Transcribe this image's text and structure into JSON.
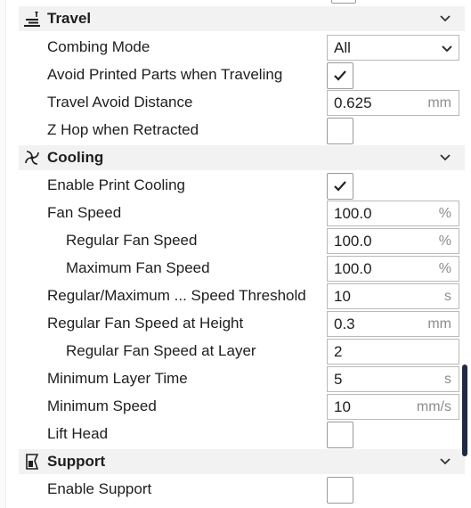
{
  "categories": {
    "travel": {
      "title": "Travel"
    },
    "cooling": {
      "title": "Cooling"
    },
    "support": {
      "title": "Support"
    }
  },
  "travel": {
    "combing_mode": {
      "label": "Combing Mode",
      "value": "All"
    },
    "avoid_printed_parts": {
      "label": "Avoid Printed Parts when Traveling",
      "checked": true
    },
    "travel_avoid_distance": {
      "label": "Travel Avoid Distance",
      "value": "0.625",
      "unit": "mm"
    },
    "z_hop": {
      "label": "Z Hop when Retracted",
      "checked": false
    }
  },
  "cooling": {
    "enable_print_cooling": {
      "label": "Enable Print Cooling",
      "checked": true
    },
    "fan_speed": {
      "label": "Fan Speed",
      "value": "100.0",
      "unit": "%"
    },
    "regular_fan_speed": {
      "label": "Regular Fan Speed",
      "value": "100.0",
      "unit": "%"
    },
    "maximum_fan_speed": {
      "label": "Maximum Fan Speed",
      "value": "100.0",
      "unit": "%"
    },
    "speed_threshold": {
      "label": "Regular/Maximum ... Speed Threshold",
      "value": "10",
      "unit": "s"
    },
    "fan_speed_height": {
      "label": "Regular Fan Speed at Height",
      "value": "0.3",
      "unit": "mm"
    },
    "fan_speed_layer": {
      "label": "Regular Fan Speed at Layer",
      "value": "2"
    },
    "min_layer_time": {
      "label": "Minimum Layer Time",
      "value": "5",
      "unit": "s"
    },
    "min_speed": {
      "label": "Minimum Speed",
      "value": "10",
      "unit": "mm/s"
    },
    "lift_head": {
      "label": "Lift Head",
      "checked": false
    }
  },
  "support": {
    "enable_support": {
      "label": "Enable Support",
      "checked": false
    }
  },
  "colors": {
    "category_bg": "#f2f2f2",
    "border": "#b9b9b9",
    "unit_text": "#8c8c8c",
    "scrollbar": "#1f2a44"
  },
  "icons": {
    "travel": "travel-icon",
    "cooling": "fan-icon",
    "support": "support-icon",
    "collapse": "chevron-down-icon",
    "check": "checkmark-icon"
  }
}
